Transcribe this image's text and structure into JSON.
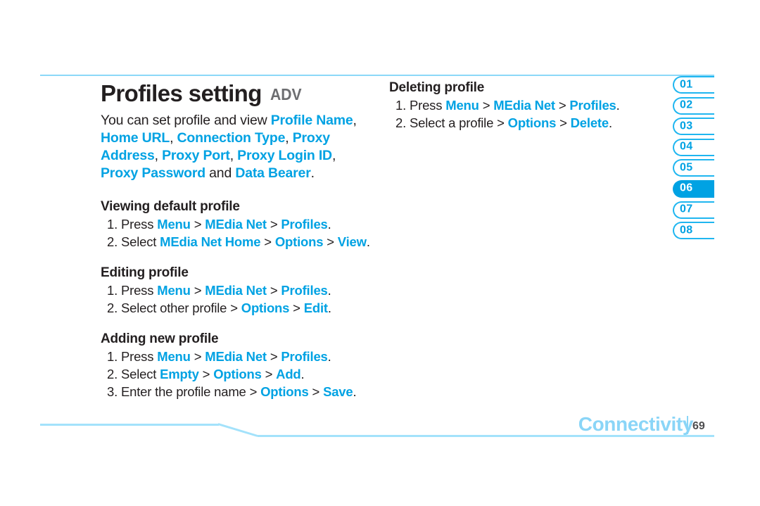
{
  "header": {
    "title": "Profiles setting",
    "badge": "ADV"
  },
  "intro": {
    "lead": "You can set profile and view ",
    "terms": [
      "Profile Name",
      "Home URL",
      "Connection Type",
      "Proxy Address",
      "Proxy Port",
      "Proxy Login ID",
      "Proxy Password",
      "Data Bearer"
    ],
    "conjunction": "and",
    "full_text": "You can set profile and view Profile Name, Home URL, Connection Type, Proxy Address, Proxy Port, Proxy Login ID, Proxy Password and Data Bearer."
  },
  "sections": {
    "viewing": {
      "heading": "Viewing default profile",
      "steps": [
        {
          "num": "1.",
          "verb": "Press",
          "path": [
            "Menu",
            "MEdia Net",
            "Profiles"
          ]
        },
        {
          "num": "2.",
          "verb": "Select",
          "path": [
            "MEdia Net Home",
            "Options",
            "View"
          ]
        }
      ]
    },
    "editing": {
      "heading": "Editing profile",
      "steps": [
        {
          "num": "1.",
          "verb": "Press",
          "path": [
            "Menu",
            "MEdia Net",
            "Profiles"
          ]
        },
        {
          "num": "2.",
          "verb": "Select",
          "plain": "other profile",
          "path": [
            "Options",
            "Edit"
          ]
        }
      ]
    },
    "adding": {
      "heading": "Adding new profile",
      "steps": [
        {
          "num": "1.",
          "verb": "Press",
          "path": [
            "Menu",
            "MEdia Net",
            "Profiles"
          ]
        },
        {
          "num": "2.",
          "verb": "Select",
          "path": [
            "Empty",
            "Options",
            "Add"
          ]
        },
        {
          "num": "3.",
          "verb": "Enter",
          "plain": "the profile name",
          "path": [
            "Options",
            "Save"
          ]
        }
      ]
    },
    "deleting": {
      "heading": "Deleting profile",
      "steps": [
        {
          "num": "1.",
          "verb": "Press",
          "path": [
            "Menu",
            "MEdia Net",
            "Profiles"
          ]
        },
        {
          "num": "2.",
          "verb": "Select",
          "plain": "a profile",
          "path": [
            "Options",
            "Delete"
          ]
        }
      ]
    }
  },
  "tab_index": {
    "items": [
      "01",
      "02",
      "03",
      "04",
      "05",
      "06",
      "07",
      "08"
    ],
    "active": "06"
  },
  "footer": {
    "chapter": "Connectivity",
    "page_number": "69"
  },
  "colors": {
    "accent_blue": "#00a2e3",
    "light_blue": "#8ad5f7",
    "rule_blue": "#a3e2fb",
    "text_dark": "#231f20",
    "badge_gray": "#6d6e71"
  }
}
